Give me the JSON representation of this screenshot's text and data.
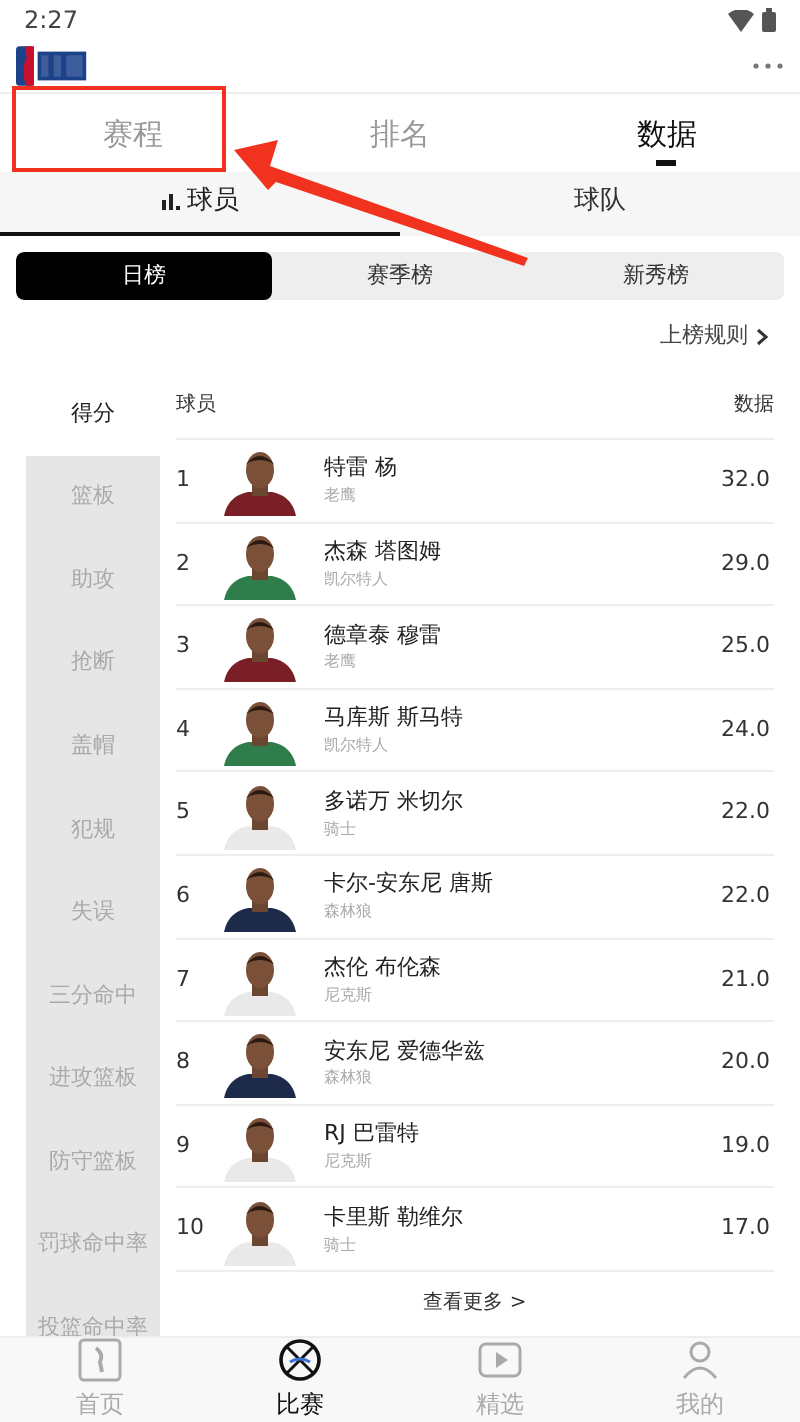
{
  "status_bar": {
    "time": "2:27"
  },
  "tabs": [
    {
      "label": "赛程",
      "selected": false
    },
    {
      "label": "排名",
      "selected": false
    },
    {
      "label": "数据",
      "selected": true
    }
  ],
  "sub_tabs": [
    {
      "label": "球员",
      "selected": true,
      "icon": true
    },
    {
      "label": "球队",
      "selected": false,
      "icon": false
    }
  ],
  "segments": [
    {
      "label": "日榜",
      "selected": true
    },
    {
      "label": "赛季榜",
      "selected": false
    },
    {
      "label": "新秀榜",
      "selected": false
    }
  ],
  "rules_link": "上榜规则",
  "categories": [
    {
      "label": "得分",
      "selected": true
    },
    {
      "label": "篮板",
      "selected": false
    },
    {
      "label": "助攻",
      "selected": false
    },
    {
      "label": "抢断",
      "selected": false
    },
    {
      "label": "盖帽",
      "selected": false
    },
    {
      "label": "犯规",
      "selected": false
    },
    {
      "label": "失误",
      "selected": false
    },
    {
      "label": "三分命中",
      "selected": false
    },
    {
      "label": "进攻篮板",
      "selected": false
    },
    {
      "label": "防守篮板",
      "selected": false
    },
    {
      "label": "罚球命中率",
      "selected": false
    },
    {
      "label": "投篮命中率",
      "selected": false
    }
  ],
  "table": {
    "columns": [
      "球员",
      "数据"
    ],
    "rows": [
      {
        "rank": "1",
        "name": "特雷 杨",
        "team": "老鹰",
        "value": "32.0"
      },
      {
        "rank": "2",
        "name": "杰森 塔图姆",
        "team": "凯尔特人",
        "value": "29.0"
      },
      {
        "rank": "3",
        "name": "德章泰 穆雷",
        "team": "老鹰",
        "value": "25.0"
      },
      {
        "rank": "4",
        "name": "马库斯 斯马特",
        "team": "凯尔特人",
        "value": "24.0"
      },
      {
        "rank": "5",
        "name": "多诺万 米切尔",
        "team": "骑士",
        "value": "22.0"
      },
      {
        "rank": "6",
        "name": "卡尔-安东尼 唐斯",
        "team": "森林狼",
        "value": "22.0"
      },
      {
        "rank": "7",
        "name": "杰伦 布伦森",
        "team": "尼克斯",
        "value": "21.0"
      },
      {
        "rank": "8",
        "name": "安东尼 爱德华兹",
        "team": "森林狼",
        "value": "20.0"
      },
      {
        "rank": "9",
        "name": "RJ 巴雷特",
        "team": "尼克斯",
        "value": "19.0"
      },
      {
        "rank": "10",
        "name": "卡里斯 勒维尔",
        "team": "骑士",
        "value": "17.0"
      }
    ]
  },
  "more_link": "查看更多 >",
  "bottom_nav": [
    {
      "label": "首页",
      "selected": false,
      "kind": "home"
    },
    {
      "label": "比赛",
      "selected": true,
      "kind": "games"
    },
    {
      "label": "精选",
      "selected": false,
      "kind": "featured"
    },
    {
      "label": "我的",
      "selected": false,
      "kind": "profile"
    }
  ]
}
